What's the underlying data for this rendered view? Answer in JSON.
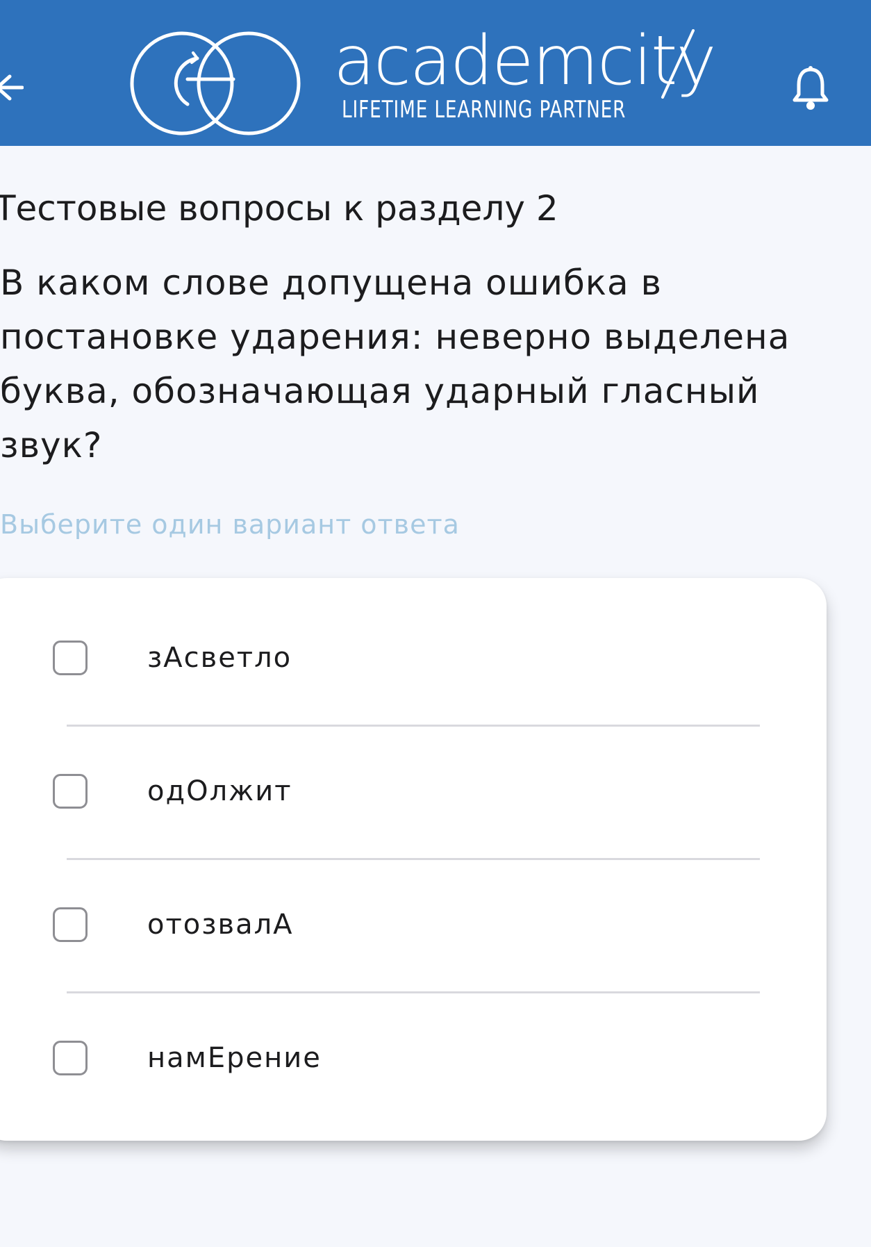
{
  "header": {
    "brand_name": "academcity",
    "tagline": "LIFETIME LEARNING PARTNER",
    "back_icon": "back-arrow-icon",
    "notification_icon": "bell-icon",
    "background_color": "#2e72bc"
  },
  "section_title": "Тестовые вопросы к разделу 2",
  "question": "В каком слове допущена ошибка в постановке ударения: неверно выделена буква, обозначающая ударный гласный звук?",
  "hint": "Выберите один вариант ответа",
  "options": [
    {
      "label": "зАсветло",
      "checked": false
    },
    {
      "label": "одОлжит",
      "checked": false
    },
    {
      "label": "отозвалА",
      "checked": false
    },
    {
      "label": "намЕрение",
      "checked": false
    }
  ]
}
